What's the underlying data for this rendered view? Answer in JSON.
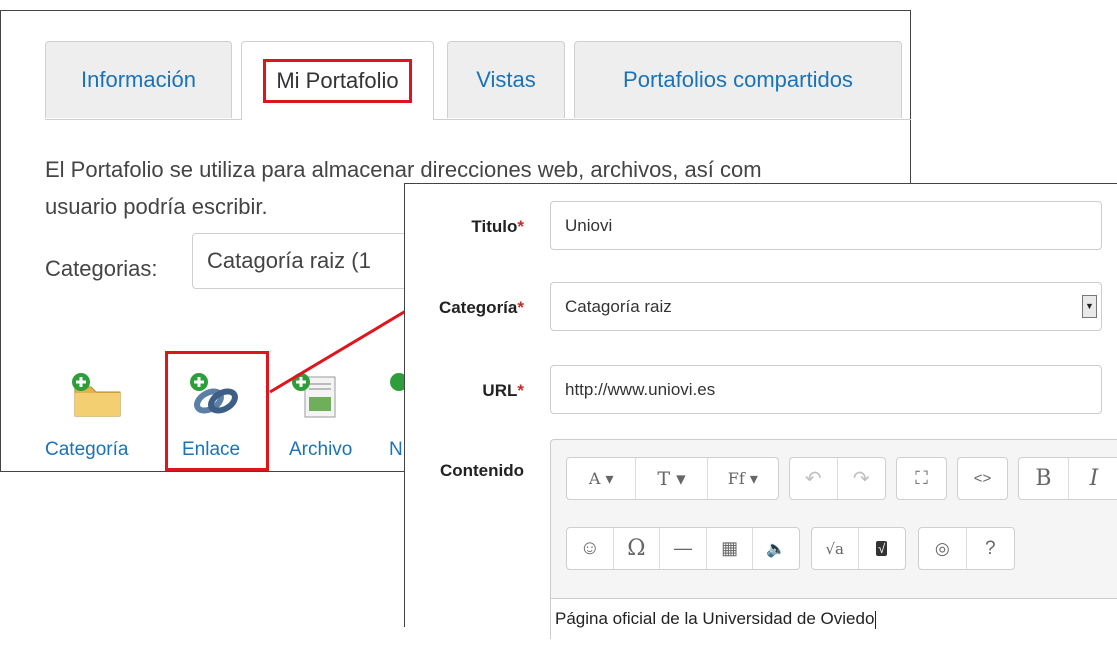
{
  "portfolio": {
    "tabs": [
      {
        "label": "Información"
      },
      {
        "label": "Mi Portafolio",
        "active": true,
        "highlighted": true
      },
      {
        "label": "Vistas"
      },
      {
        "label": "Portafolios compartidos"
      }
    ],
    "description_line1": "El Portafolio se utiliza para almacenar direcciones web, archivos, así com",
    "description_line2": "usuario podría escribir.",
    "categories_label": "Categorias:",
    "categories_value": "Catagoría raiz (1",
    "actions": [
      {
        "label": "Categoría",
        "icon": "folder-add-icon"
      },
      {
        "label": "Enlace",
        "icon": "link-add-icon",
        "highlighted": true
      },
      {
        "label": "Archivo",
        "icon": "file-add-icon"
      },
      {
        "label": "N",
        "icon": "note-add-icon"
      }
    ]
  },
  "form": {
    "title_label": "Titulo",
    "title_value": "Uniovi",
    "category_label": "Categoría",
    "category_value": "Catagoría raiz",
    "url_label": "URL",
    "url_value": "http://www.uniovi.es",
    "content_label": "Contenido",
    "required_mark": "*",
    "content_value": "Página oficial de la Universidad de Oviedo",
    "toolbar": {
      "font_size": "A",
      "format": "T",
      "font_family": "Ff",
      "undo": "↶",
      "redo": "↷",
      "fullscreen": "⛶",
      "source": "<>",
      "bold": "B",
      "italic": "I",
      "emoticon": "☺",
      "special_char": "Ω",
      "hr": "—",
      "table": "▦",
      "media": "🔈",
      "math": "√a",
      "math_fill": "√",
      "preview": "◎",
      "spellcheck": "?"
    }
  },
  "colors": {
    "link_blue": "#1a73b8",
    "highlight_red": "#e0141b",
    "required_red": "#c62a2a"
  }
}
